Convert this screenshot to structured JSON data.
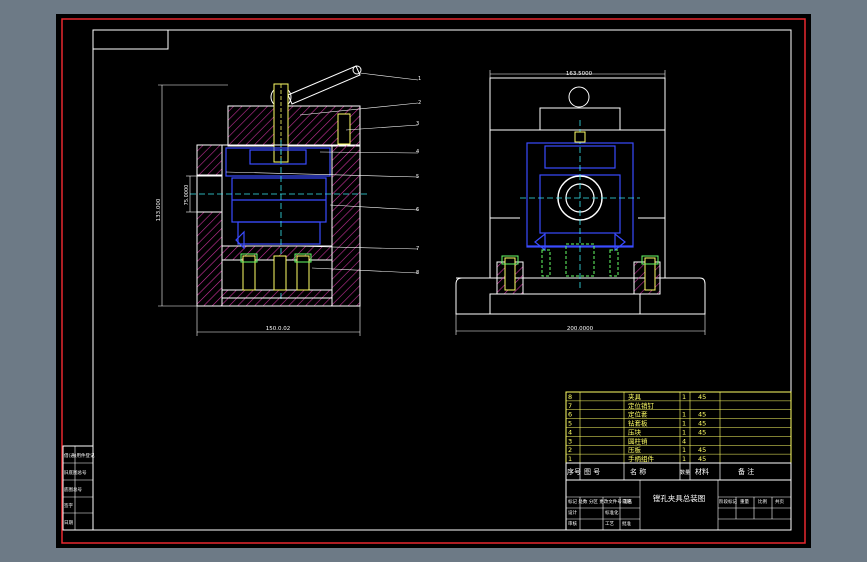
{
  "colors": {
    "background": "#6d7a86",
    "paper": "#000000",
    "outer_border": "#e8282f",
    "frame": "#ffffff",
    "hatch": "#c8329a",
    "blue": "#3a4bff",
    "yellow": "#ffff66",
    "green": "#66ff66",
    "cyan": "#39e8f0",
    "red": "#ff3030"
  },
  "dimensions": {
    "front_height": "133.000",
    "front_inner": "75.0000",
    "front_width": "150.0.02",
    "side_top_width": "163.5000",
    "side_base_width": "200.0000"
  },
  "balloons": [
    "1",
    "2",
    "3",
    "4",
    "5",
    "6",
    "7",
    "8"
  ],
  "bom": {
    "rows": [
      {
        "no": "8",
        "name": "夹具",
        "qty": "1",
        "material": "45"
      },
      {
        "no": "7",
        "name": "定位销钉",
        "qty": "",
        "material": ""
      },
      {
        "no": "6",
        "name": "定位套",
        "qty": "1",
        "material": "45"
      },
      {
        "no": "5",
        "name": "钻套板",
        "qty": "1",
        "material": "45"
      },
      {
        "no": "4",
        "name": "压块",
        "qty": "1",
        "material": "45"
      },
      {
        "no": "3",
        "name": "圆柱销",
        "qty": "4",
        "material": ""
      },
      {
        "no": "2",
        "name": "压板",
        "qty": "1",
        "material": "45"
      },
      {
        "no": "1",
        "name": "手柄组件",
        "qty": "1",
        "material": "45"
      }
    ],
    "header": {
      "no": "序号",
      "code": "图  号",
      "name": "名    称",
      "qty": "数量",
      "material": "材料",
      "note": "备  注"
    }
  },
  "title_block": {
    "drawing_title": "镗孔夹具总装图",
    "scale_labels": [
      "阶段标记",
      "重量",
      "比例",
      "共页"
    ],
    "rows": [
      "标记 处数 分区 更改文件号 签名",
      "设计",
      "审核",
      "工艺",
      "批准"
    ],
    "sign_cells": [
      "标准化",
      "日期"
    ]
  },
  "left_strip": [
    "借(通)用件登记",
    "旧底图总号",
    "底图总号",
    "签字",
    "日期"
  ]
}
